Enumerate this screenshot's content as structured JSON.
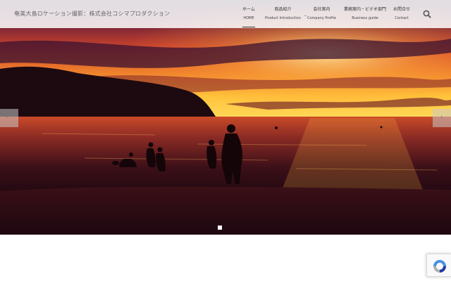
{
  "header": {
    "site_title": "奄美大島ロケーション撮影：株式会社コシマプロダクション"
  },
  "nav": {
    "items": [
      {
        "label_jp": "ホーム",
        "label_en": "HOME"
      },
      {
        "label_jp": "商品紹介",
        "label_en": "Product Introduction"
      },
      {
        "label_jp": "会社案内",
        "label_en": "Company Profile"
      },
      {
        "label_jp": "業務案内・ビデオ部門",
        "label_en": "Business guide"
      },
      {
        "label_jp": "お問合せ",
        "label_en": "Contact"
      }
    ],
    "active_index": 0
  },
  "icons": {
    "search": "search-icon",
    "dropdown": "chevron-down-icon",
    "prev": "chevron-left-icon",
    "next": "chevron-right-icon",
    "recaptcha": "recaptcha-icon"
  },
  "slider": {
    "prev_glyph": "‹",
    "next_glyph": "›",
    "slide_count": 1,
    "current_slide": 1
  },
  "colors": {
    "header_bg": "#ffffff",
    "sky_top": "#3a1a3c",
    "sky_glow": "#f07a2a",
    "horizon_glow": "#ffcf3a",
    "sea": "#2a0c14"
  }
}
